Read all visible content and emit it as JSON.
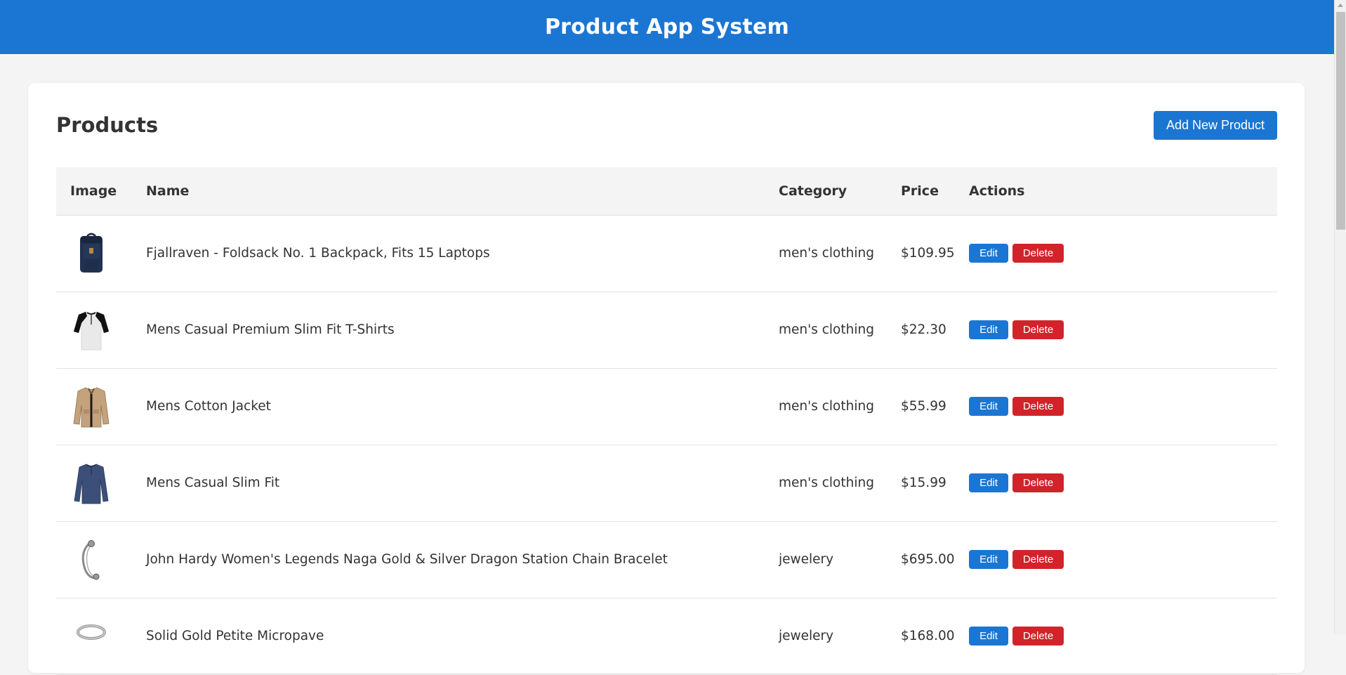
{
  "app": {
    "title": "Product App System"
  },
  "page": {
    "heading": "Products",
    "add_button": "Add New Product"
  },
  "table": {
    "headers": [
      "Image",
      "Name",
      "Category",
      "Price",
      "Actions"
    ],
    "rows": [
      {
        "image_icon": "backpack-icon",
        "name": "Fjallraven - Foldsack No. 1 Backpack, Fits 15 Laptops",
        "category": "men's clothing",
        "price": "$109.95",
        "edit": "Edit",
        "delete": "Delete"
      },
      {
        "image_icon": "tshirt-icon",
        "name": "Mens Casual Premium Slim Fit T-Shirts",
        "category": "men's clothing",
        "price": "$22.30",
        "edit": "Edit",
        "delete": "Delete"
      },
      {
        "image_icon": "jacket-icon",
        "name": "Mens Cotton Jacket",
        "category": "men's clothing",
        "price": "$55.99",
        "edit": "Edit",
        "delete": "Delete"
      },
      {
        "image_icon": "longsleeve-icon",
        "name": "Mens Casual Slim Fit",
        "category": "men's clothing",
        "price": "$15.99",
        "edit": "Edit",
        "delete": "Delete"
      },
      {
        "image_icon": "bracelet-icon",
        "name": "John Hardy Women's Legends Naga Gold & Silver Dragon Station Chain Bracelet",
        "category": "jewelery",
        "price": "$695.00",
        "edit": "Edit",
        "delete": "Delete"
      },
      {
        "image_icon": "ring-icon",
        "name": "Solid Gold Petite Micropave",
        "category": "jewelery",
        "price": "$168.00",
        "edit": "Edit",
        "delete": "Delete"
      }
    ]
  },
  "colors": {
    "primary": "#1b76d3",
    "danger": "#d2232a",
    "background": "#f4f4f4"
  }
}
